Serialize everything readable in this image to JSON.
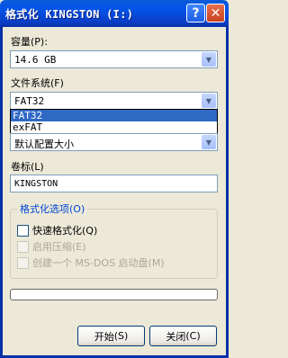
{
  "window": {
    "title": "格式化 KINGSTON (I:)",
    "help_label": "?",
    "close_label": "✕"
  },
  "capacity": {
    "label": "容量",
    "mnemonic": "(P):",
    "value": "14.6 GB"
  },
  "filesystem": {
    "label": "文件系统",
    "mnemonic": "(F)",
    "value": "FAT32",
    "options": [
      "FAT32",
      "exFAT"
    ]
  },
  "allocation": {
    "value": "默认配置大小"
  },
  "volume_label": {
    "label": "卷标",
    "mnemonic": "(L)",
    "value": "KINGSTON"
  },
  "format_options": {
    "title": "格式化选项",
    "mnemonic": "(O)",
    "quick_format": {
      "label": "快速格式化",
      "mnemonic": "(Q)",
      "checked": false
    },
    "compression": {
      "label": "启用压缩",
      "mnemonic": "(E)",
      "checked": false
    },
    "msdos_disk": {
      "label": "创建一个 MS-DOS 启动盘",
      "mnemonic": "(M)",
      "checked": false
    }
  },
  "buttons": {
    "start_label": "开始",
    "start_mnemonic": "(S)",
    "close_label": "关闭",
    "close_mnemonic": "(C)"
  },
  "progress": 0,
  "colors": {
    "titlebar": "#0453e8",
    "selection": "#316ac5",
    "group_title": "#0046d5",
    "dialog_bg": "#ece9d8"
  }
}
